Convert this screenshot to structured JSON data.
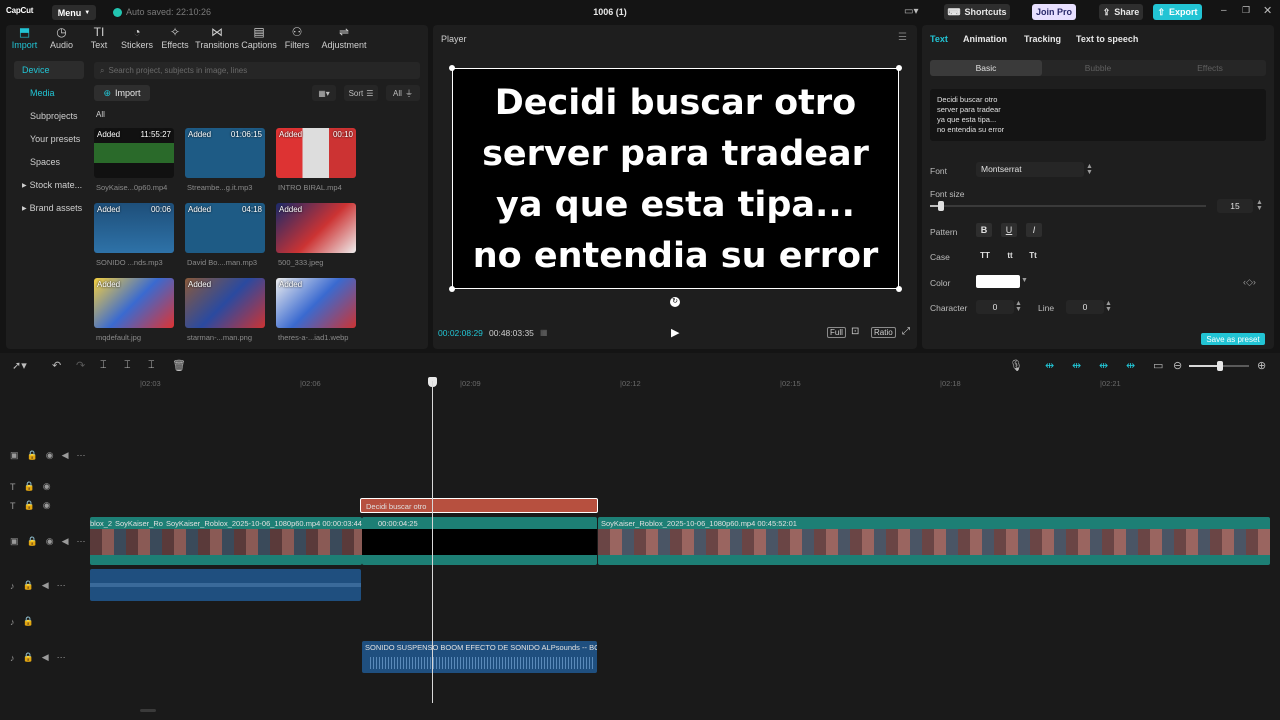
{
  "app": {
    "logo": "CapCut",
    "menu_label": "Menu",
    "autosave": "Auto saved: 22:10:26",
    "project_title": "1006 (1)",
    "shortcuts_label": "Shortcuts",
    "joinpro_label": "Join Pro",
    "share_label": "Share",
    "export_label": "Export"
  },
  "colors": {
    "accent": "#22c4d4",
    "timeline_video": "#1d7f75",
    "text_clip": "#b7503f",
    "audio_clip": "#1f4f7f"
  },
  "media_toolbar": [
    {
      "label": "Import",
      "icon": "import-icon",
      "active": true
    },
    {
      "label": "Audio",
      "icon": "audio-icon"
    },
    {
      "label": "Text",
      "icon": "text-icon"
    },
    {
      "label": "Stickers",
      "icon": "sticker-icon"
    },
    {
      "label": "Effects",
      "icon": "effects-icon"
    },
    {
      "label": "Transitions",
      "icon": "transition-icon"
    },
    {
      "label": "Captions",
      "icon": "captions-icon"
    },
    {
      "label": "Filters",
      "icon": "filter-icon"
    },
    {
      "label": "Adjustment",
      "icon": "adjustment-icon"
    }
  ],
  "sidenav": {
    "device": "Device",
    "media": "Media",
    "subprojects": "Subprojects",
    "presets": "Your presets",
    "spaces": "Spaces",
    "stock": "Stock mate...",
    "brand": "Brand assets"
  },
  "media": {
    "search_placeholder": "Search project, subjects in image, lines",
    "import_label": "Import",
    "sort_label": "Sort",
    "all_filter": "All",
    "all_label": "All",
    "added": "Added",
    "items": [
      {
        "name": "SoyKaise...0p60.mp4",
        "dur": "11:55:27"
      },
      {
        "name": "Streambe...g.it.mp3",
        "dur": "01:06:15"
      },
      {
        "name": "INTRO BIRAL.mp4",
        "dur": "00:10"
      },
      {
        "name": "SONIDO ...nds.mp3",
        "dur": "00:06"
      },
      {
        "name": "David Bo....man.mp3",
        "dur": "04:18"
      },
      {
        "name": "500_333.jpeg",
        "dur": ""
      },
      {
        "name": "mqdefault.jpg",
        "dur": ""
      },
      {
        "name": "starman-...man.png",
        "dur": ""
      },
      {
        "name": "theres-a-...iad1.webp",
        "dur": ""
      }
    ]
  },
  "player": {
    "title": "Player",
    "caption": "Decidi buscar otro\nserver para tradear\nya que esta tipa...\nno entendia su error",
    "current_time": "00:02:08:29",
    "total_time": "00:48:03:35",
    "full_label": "Full",
    "ratio_label": "Ratio"
  },
  "inspector": {
    "tabs": [
      "Text",
      "Animation",
      "Tracking",
      "Text to speech"
    ],
    "segments": [
      "Basic",
      "Bubble",
      "Effects"
    ],
    "text_content": "Decidi buscar otro\nserver para tradear\nya que esta tipa...\nno entendia su error",
    "font_label": "Font",
    "font_value": "Montserrat",
    "font_size_label": "Font size",
    "font_size": 15,
    "pattern_label": "Pattern",
    "pattern_b": "B",
    "pattern_u": "U",
    "pattern_i": "I",
    "case_label": "Case",
    "case_upper": "TT",
    "case_lower": "tt",
    "case_title": "Tt",
    "color_label": "Color",
    "character_label": "Character",
    "character_value": "0",
    "line_label": "Line",
    "line_value": "0",
    "save_preset": "Save as preset"
  },
  "timeline": {
    "ticks": [
      "|02:03",
      "|02:06",
      "|02:09",
      "|02:12",
      "|02:15",
      "|02:18",
      "|02:21"
    ],
    "text_clip": "Decidi buscar otro",
    "video_clips": [
      "blox_2",
      "SoyKaiser_Ro",
      "SoyKaiser_Roblox_2025-10-06_1080p60.mp4   00:00:03:44",
      "00:00:04:25",
      "SoyKaiser_Roblox_2025-10-06_1080p60.mp4   00:45:52:01"
    ],
    "audio_clip": "SONIDO SUSPENSO BOOM  EFECTO DE SONIDO  ALPsounds -- BC"
  }
}
